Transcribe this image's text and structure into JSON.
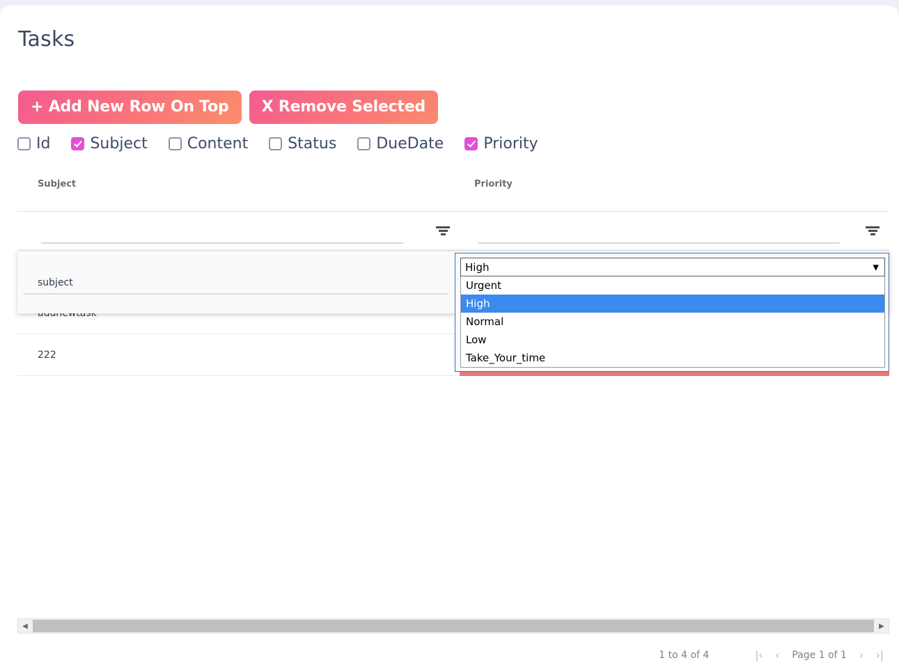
{
  "page": {
    "title": "Tasks"
  },
  "toolbar": {
    "add_row_label": "+ Add New Row On Top",
    "remove_selected_label": "X Remove Selected"
  },
  "column_toggles": [
    {
      "label": "Id",
      "checked": false
    },
    {
      "label": "Subject",
      "checked": true
    },
    {
      "label": "Content",
      "checked": false
    },
    {
      "label": "Status",
      "checked": false
    },
    {
      "label": "DueDate",
      "checked": false
    },
    {
      "label": "Priority",
      "checked": true
    }
  ],
  "grid": {
    "columns": [
      {
        "header": "Subject"
      },
      {
        "header": "Priority"
      }
    ],
    "filters": [
      {
        "value": "",
        "placeholder": ""
      },
      {
        "value": "",
        "placeholder": ""
      }
    ],
    "rows": [
      {
        "subject": "subject",
        "priority": "High",
        "priority_color": "high"
      },
      {
        "subject": "addnewtask",
        "priority": "Low",
        "priority_color": "low"
      },
      {
        "subject": "222",
        "priority": "Urgent",
        "priority_color": "urgent"
      }
    ]
  },
  "editor": {
    "subject_value": "subject",
    "subject_placeholder": "",
    "select": {
      "value": "High",
      "caret": "▼",
      "options": [
        {
          "label": "Urgent",
          "selected": false
        },
        {
          "label": "High",
          "selected": true
        },
        {
          "label": "Normal",
          "selected": false
        },
        {
          "label": "Low",
          "selected": false
        },
        {
          "label": "Take_Your_time",
          "selected": false
        }
      ]
    }
  },
  "scrollbar": {
    "left_arrow": "◀",
    "right_arrow": "▶"
  },
  "pagination": {
    "range": "1 to 4 of 4",
    "first": "|‹",
    "prev": "‹",
    "page_label": "Page 1 of 1",
    "next": "›",
    "last": "›|"
  },
  "colors": {
    "accent_checkbox": "#e34fd6",
    "button_gradient_start": "#f45b8f",
    "button_gradient_end": "#fa8e6b",
    "row_urgent": "#e57a7a",
    "row_low": "#90ee90",
    "option_highlight": "#3b8aee",
    "page_bg": "#eef0f5"
  }
}
